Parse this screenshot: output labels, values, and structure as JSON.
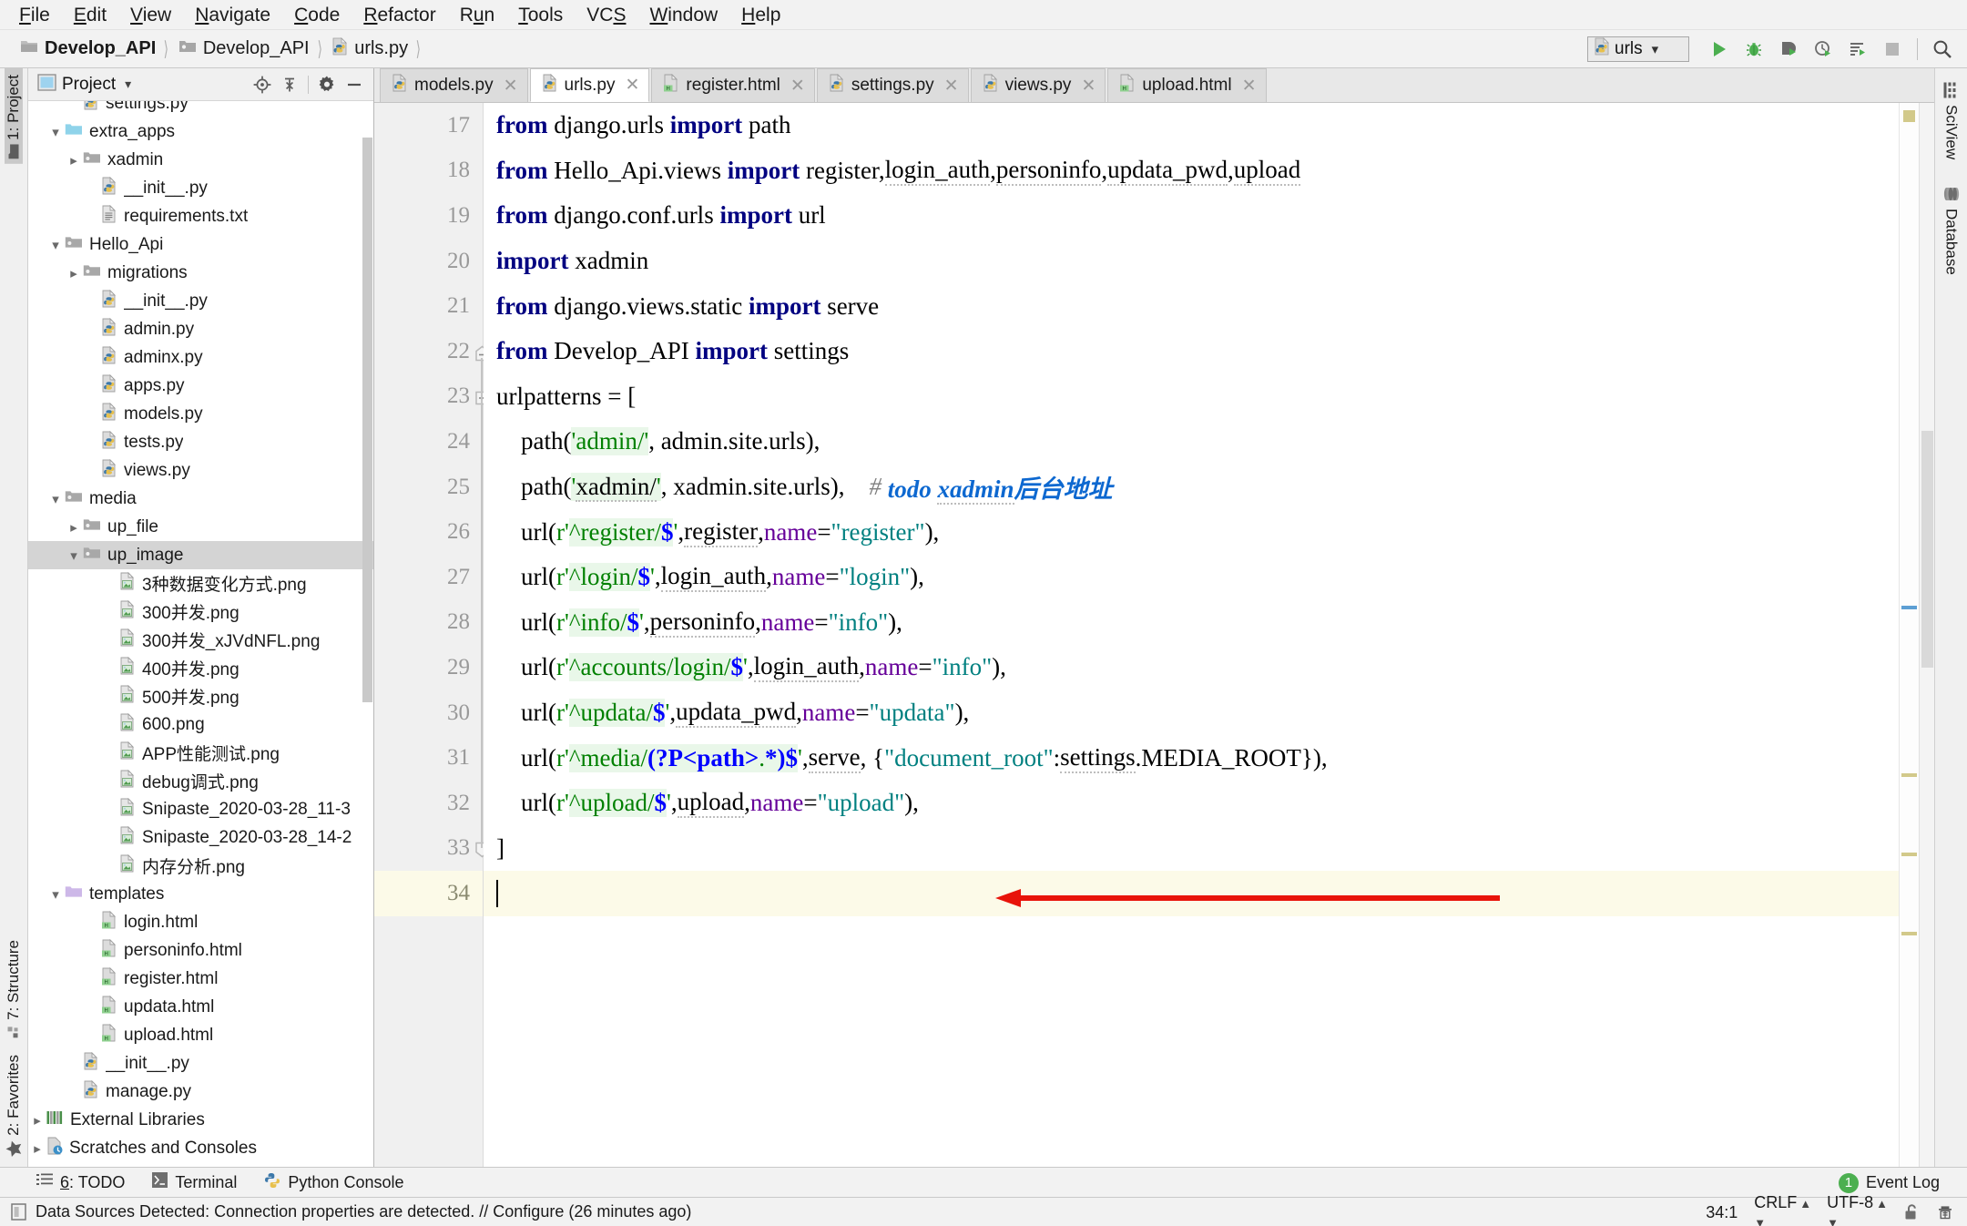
{
  "menubar": {
    "items": [
      "File",
      "Edit",
      "View",
      "Navigate",
      "Code",
      "Refactor",
      "Run",
      "Tools",
      "VCS",
      "Window",
      "Help"
    ]
  },
  "breadcrumb": {
    "items": [
      "Develop_API",
      "Develop_API",
      "urls.py"
    ]
  },
  "toolbar": {
    "run_config": "urls",
    "icons": [
      "run-icon",
      "debug-icon",
      "coverage-icon",
      "profile-icon",
      "run-with-params-icon",
      "stop-icon",
      "search-everywhere-icon"
    ]
  },
  "project_panel": {
    "title": "Project",
    "header_icons": [
      "locate-icon",
      "collapse-all-icon",
      "settings-gear-icon",
      "hide-icon"
    ],
    "tree": [
      {
        "indent": 2,
        "label": "settings.py",
        "icon": "python-file-icon",
        "arrow": "",
        "clipped": true
      },
      {
        "indent": 1,
        "label": "extra_apps",
        "icon": "folder-blue-icon",
        "arrow": "down"
      },
      {
        "indent": 2,
        "label": "xadmin",
        "icon": "folder-icon",
        "arrow": "right"
      },
      {
        "indent": 3,
        "label": "__init__.py",
        "icon": "python-file-icon",
        "arrow": ""
      },
      {
        "indent": 3,
        "label": "requirements.txt",
        "icon": "text-file-icon",
        "arrow": ""
      },
      {
        "indent": 1,
        "label": "Hello_Api",
        "icon": "folder-icon",
        "arrow": "down"
      },
      {
        "indent": 2,
        "label": "migrations",
        "icon": "folder-icon",
        "arrow": "right"
      },
      {
        "indent": 3,
        "label": "__init__.py",
        "icon": "python-file-icon",
        "arrow": ""
      },
      {
        "indent": 3,
        "label": "admin.py",
        "icon": "python-file-icon",
        "arrow": ""
      },
      {
        "indent": 3,
        "label": "adminx.py",
        "icon": "python-file-icon",
        "arrow": ""
      },
      {
        "indent": 3,
        "label": "apps.py",
        "icon": "python-file-icon",
        "arrow": ""
      },
      {
        "indent": 3,
        "label": "models.py",
        "icon": "python-file-icon",
        "arrow": ""
      },
      {
        "indent": 3,
        "label": "tests.py",
        "icon": "python-file-icon",
        "arrow": ""
      },
      {
        "indent": 3,
        "label": "views.py",
        "icon": "python-file-icon",
        "arrow": ""
      },
      {
        "indent": 1,
        "label": "media",
        "icon": "folder-icon",
        "arrow": "down"
      },
      {
        "indent": 2,
        "label": "up_file",
        "icon": "folder-icon",
        "arrow": "right"
      },
      {
        "indent": 2,
        "label": "up_image",
        "icon": "folder-icon",
        "arrow": "down",
        "selected": true
      },
      {
        "indent": 4,
        "label": "3种数据变化方式.png",
        "icon": "image-file-icon",
        "arrow": ""
      },
      {
        "indent": 4,
        "label": "300并发.png",
        "icon": "image-file-icon",
        "arrow": ""
      },
      {
        "indent": 4,
        "label": "300并发_xJVdNFL.png",
        "icon": "image-file-icon",
        "arrow": ""
      },
      {
        "indent": 4,
        "label": "400并发.png",
        "icon": "image-file-icon",
        "arrow": ""
      },
      {
        "indent": 4,
        "label": "500并发.png",
        "icon": "image-file-icon",
        "arrow": ""
      },
      {
        "indent": 4,
        "label": "600.png",
        "icon": "image-file-icon",
        "arrow": ""
      },
      {
        "indent": 4,
        "label": "APP性能测试.png",
        "icon": "image-file-icon",
        "arrow": ""
      },
      {
        "indent": 4,
        "label": "debug调式.png",
        "icon": "image-file-icon",
        "arrow": ""
      },
      {
        "indent": 4,
        "label": "Snipaste_2020-03-28_11-3",
        "icon": "image-file-icon",
        "arrow": ""
      },
      {
        "indent": 4,
        "label": "Snipaste_2020-03-28_14-2",
        "icon": "image-file-icon",
        "arrow": ""
      },
      {
        "indent": 4,
        "label": "内存分析.png",
        "icon": "image-file-icon",
        "arrow": ""
      },
      {
        "indent": 1,
        "label": "templates",
        "icon": "folder-purple-icon",
        "arrow": "down"
      },
      {
        "indent": 3,
        "label": "login.html",
        "icon": "html-file-icon",
        "arrow": ""
      },
      {
        "indent": 3,
        "label": "personinfo.html",
        "icon": "html-file-icon",
        "arrow": ""
      },
      {
        "indent": 3,
        "label": "register.html",
        "icon": "html-file-icon",
        "arrow": ""
      },
      {
        "indent": 3,
        "label": "updata.html",
        "icon": "html-file-icon",
        "arrow": ""
      },
      {
        "indent": 3,
        "label": "upload.html",
        "icon": "html-file-icon",
        "arrow": ""
      },
      {
        "indent": 2,
        "label": "__init__.py",
        "icon": "python-file-icon",
        "arrow": ""
      },
      {
        "indent": 2,
        "label": "manage.py",
        "icon": "python-file-icon",
        "arrow": ""
      },
      {
        "indent": 0,
        "label": "External Libraries",
        "icon": "library-icon",
        "arrow": "right"
      },
      {
        "indent": 0,
        "label": "Scratches and Consoles",
        "icon": "scratches-icon",
        "arrow": "right",
        "clipped": true
      }
    ]
  },
  "left_toolwindows": [
    {
      "label": "1: Project",
      "icon": "project-folder-icon",
      "active": true
    },
    {
      "label": "7: Structure",
      "icon": "structure-icon",
      "active": false
    },
    {
      "label": "2: Favorites",
      "icon": "star-icon",
      "active": false
    }
  ],
  "right_toolwindows": [
    {
      "label": "SciView",
      "icon": "sciview-grid-icon"
    },
    {
      "label": "Database",
      "icon": "database-icon"
    }
  ],
  "editor_tabs": [
    {
      "label": "models.py",
      "icon": "python-file-icon",
      "active": false
    },
    {
      "label": "urls.py",
      "icon": "python-file-icon",
      "active": true
    },
    {
      "label": "register.html",
      "icon": "html-file-icon",
      "active": false
    },
    {
      "label": "settings.py",
      "icon": "python-file-icon",
      "active": false
    },
    {
      "label": "views.py",
      "icon": "python-file-icon",
      "active": false
    },
    {
      "label": "upload.html",
      "icon": "html-file-icon",
      "active": false
    }
  ],
  "editor": {
    "filename": "urls.py",
    "first_visible_line": 17,
    "current_line": 34,
    "lines": [
      {
        "n": 17,
        "fold": ""
      },
      {
        "n": 18,
        "fold": ""
      },
      {
        "n": 19,
        "fold": ""
      },
      {
        "n": 20,
        "fold": ""
      },
      {
        "n": 21,
        "fold": ""
      },
      {
        "n": 22,
        "fold": "top"
      },
      {
        "n": 23,
        "fold": "mid"
      },
      {
        "n": 24,
        "fold": ""
      },
      {
        "n": 25,
        "fold": ""
      },
      {
        "n": 26,
        "fold": ""
      },
      {
        "n": 27,
        "fold": ""
      },
      {
        "n": 28,
        "fold": ""
      },
      {
        "n": 29,
        "fold": ""
      },
      {
        "n": 30,
        "fold": ""
      },
      {
        "n": 31,
        "fold": ""
      },
      {
        "n": 32,
        "fold": ""
      },
      {
        "n": 33,
        "fold": "end"
      },
      {
        "n": 34,
        "fold": "",
        "current": true
      }
    ],
    "source_plain": [
      "from django.urls import path",
      "from Hello_Api.views import register,login_auth,personinfo,updata_pwd,upload",
      "from django.conf.urls import url",
      "import xadmin",
      "from django.views.static import serve",
      "from Develop_API import settings",
      "urlpatterns = [",
      "    path('admin/', admin.site.urls),",
      "    path('xadmin/', xadmin.site.urls),    # todo xadmin后台地址",
      "    url(r'^register/$',register,name=\"register\"),",
      "    url(r'^login/$',login_auth,name=\"login\"),",
      "    url(r'^info/$',personinfo,name=\"info\"),",
      "    url(r'^accounts/login/$',login_auth,name=\"info\"),",
      "    url(r'^updata/$',updata_pwd,name=\"updata\"),",
      "    url(r'^media/(?P<path>.*)$',serve,{\"document_root\":settings.MEDIA_ROOT}),",
      "    url(r'^upload/$',upload,name=\"upload\"),",
      "]",
      ""
    ]
  },
  "annotation": {
    "type": "red-arrow",
    "color": "#e8130a",
    "points_to_line": 32,
    "direction": "left"
  },
  "bottom_toolstrip": {
    "items": [
      {
        "label": "6: TODO",
        "icon": "todo-list-icon"
      },
      {
        "label": "Terminal",
        "icon": "terminal-icon"
      },
      {
        "label": "Python Console",
        "icon": "python-console-icon"
      }
    ],
    "event_log": {
      "label": "Event Log",
      "count": "1"
    }
  },
  "statusbar": {
    "message": "Data Sources Detected: Connection properties are detected. // Configure (26 minutes ago)",
    "message_icon": "database-notice-icon",
    "caret_position": "34:1",
    "line_separator": "CRLF",
    "encoding": "UTF-8",
    "lock_icon": "unlocked-padlock-icon",
    "inspection_icon": "hector-inspector-icon"
  },
  "colors": {
    "keyword": "#000080",
    "string": "#008000",
    "string_double": "#008080",
    "kwarg": "#660099",
    "regex_meta": "#0000ff",
    "regex_bg": "#e9f7e9",
    "comment": "#808080",
    "todo": "#0d68d0",
    "annotation_red": "#e8130a",
    "current_line_bg": "#fcfae8",
    "selection_bg": "#d4d4d4",
    "badge_green": "#4caf50"
  }
}
